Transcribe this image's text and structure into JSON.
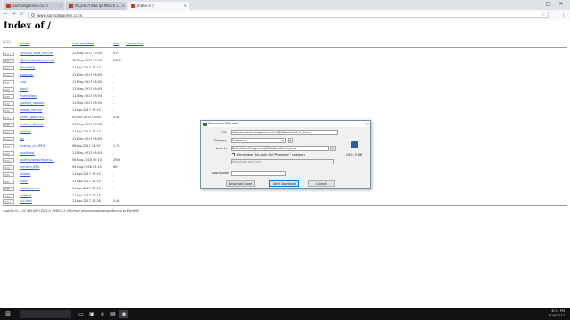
{
  "browser": {
    "tabs": [
      {
        "title": "Samsatgarden.co.in"
      },
      {
        "title": "IPL2017/Tata Ipl Match 2..."
      },
      {
        "title": "Index of /"
      }
    ],
    "address": "www.samsatgarden.co.in",
    "window_controls": [
      "–",
      "□",
      "✕"
    ]
  },
  "page": {
    "heading": "Index of /",
    "columns": {
      "icon": "[ICO]",
      "name": "Name",
      "modified": "Last modified",
      "size": "Size",
      "description": "Description"
    },
    "rows": [
      {
        "icon": "[TXT]",
        "name": "@Sonia_Boss_hdd.csv",
        "date": "12-May-2017 15:09",
        "size": "915"
      },
      {
        "icon": "[IMG]",
        "name": "@Mobotbuilder1_4.csv",
        "date": "12-May-2017 15:12",
        "size": "2660"
      },
      {
        "icon": "[DIR]",
        "name": "Bilal/TNT/",
        "date": "11-Apr-2017 17:15",
        "size": "-"
      },
      {
        "icon": "[DIR]",
        "name": "captcha/",
        "date": "11-May-2017 05:03",
        "size": "-"
      },
      {
        "icon": "[DIR]",
        "name": "css/",
        "date": "11-May-2017 05:03",
        "size": "-"
      },
      {
        "icon": "[DIR]",
        "name": "font/",
        "date": "11-May-2017 05:03",
        "size": "-"
      },
      {
        "icon": "[DIR]",
        "name": "FormsNew/",
        "date": "11-May-2017 05:03",
        "size": "-"
      },
      {
        "icon": "[DIR]",
        "name": "gadget_upload/",
        "date": "11-May-2017 05:03",
        "size": "-"
      },
      {
        "icon": "[DIR]",
        "name": "image_library/",
        "date": "11-Apr-2017 17:15",
        "size": "-"
      },
      {
        "icon": "[IMG]",
        "name": "index_gap.JPEG",
        "date": "05-Oct-2015 05:05",
        "size": "3.4k"
      },
      {
        "icon": "[DIR]",
        "name": "invoice_Global/",
        "date": "11-May-2017 05:03",
        "size": "-"
      },
      {
        "icon": "[DIR]",
        "name": "jquery/",
        "date": "11-Apr-2017 17:15",
        "size": "-"
      },
      {
        "icon": "[DIR]",
        "name": "js/",
        "date": "11-May-2017 05:03",
        "size": "-"
      },
      {
        "icon": "[IMG]",
        "name": "license_icn.JPEG",
        "date": "06-Jan-2012 14:53",
        "size": "1.7k"
      },
      {
        "icon": "[DIR]",
        "name": "modules/",
        "date": "11-May-2017 05:03",
        "size": "-"
      },
      {
        "icon": "[IMG]",
        "name": "overlaybackvillage.p...",
        "date": "06-Aug-2016 05:15",
        "size": "256k"
      },
      {
        "icon": "[IMG]",
        "name": "sm-alm.JPEG",
        "date": "05-Aug-2016 05:15",
        "size": "694"
      },
      {
        "icon": "[DIR]",
        "name": "Slides/",
        "date": "11-Apr-2017 17:15",
        "size": "-"
      },
      {
        "icon": "[DIR]",
        "name": "Swal/",
        "date": "11-Apr-2017 17:15",
        "size": "-"
      },
      {
        "icon": "[DIR]",
        "name": "Validanomic/",
        "date": "11-Apr-2017 17:15",
        "size": "-"
      },
      {
        "icon": "[DIR]",
        "name": "videos/",
        "date": "11-Apr-2017 17:15",
        "size": "-"
      },
      {
        "icon": "[TXT]",
        "name": "x1.html",
        "date": "12-Apr-2017 17:28",
        "size": "3.4k"
      }
    ],
    "footer": "Apache/2.2.31 (Win32) DAV/2 PHP/5.2.9 Server at www.samsatgarden.co.in Port 80"
  },
  "dialog": {
    "title": "Download File Info",
    "url_label": "URL",
    "url_value": "http://www.samsatgarden.co.in/@Mobotbuilder1_4.csv",
    "category_label": "Category",
    "category_value": "Programs",
    "saveas_label": "Save As",
    "saveas_value": "D:\\Installed\\Programs\\@Mobotbuilder1_4.csv",
    "remember_label": "Remember this path for \"Programs\" category",
    "description_label": "Description",
    "disabled_field": "Download from here",
    "add_btn": "+",
    "browse_btn": "...",
    "file_size": "240.15 KB",
    "buttons": {
      "later": "Download Later",
      "start": "Start Download",
      "cancel": "Cancel"
    }
  },
  "tray": {
    "time": "8:11 PM",
    "date": "5/18/2017"
  }
}
